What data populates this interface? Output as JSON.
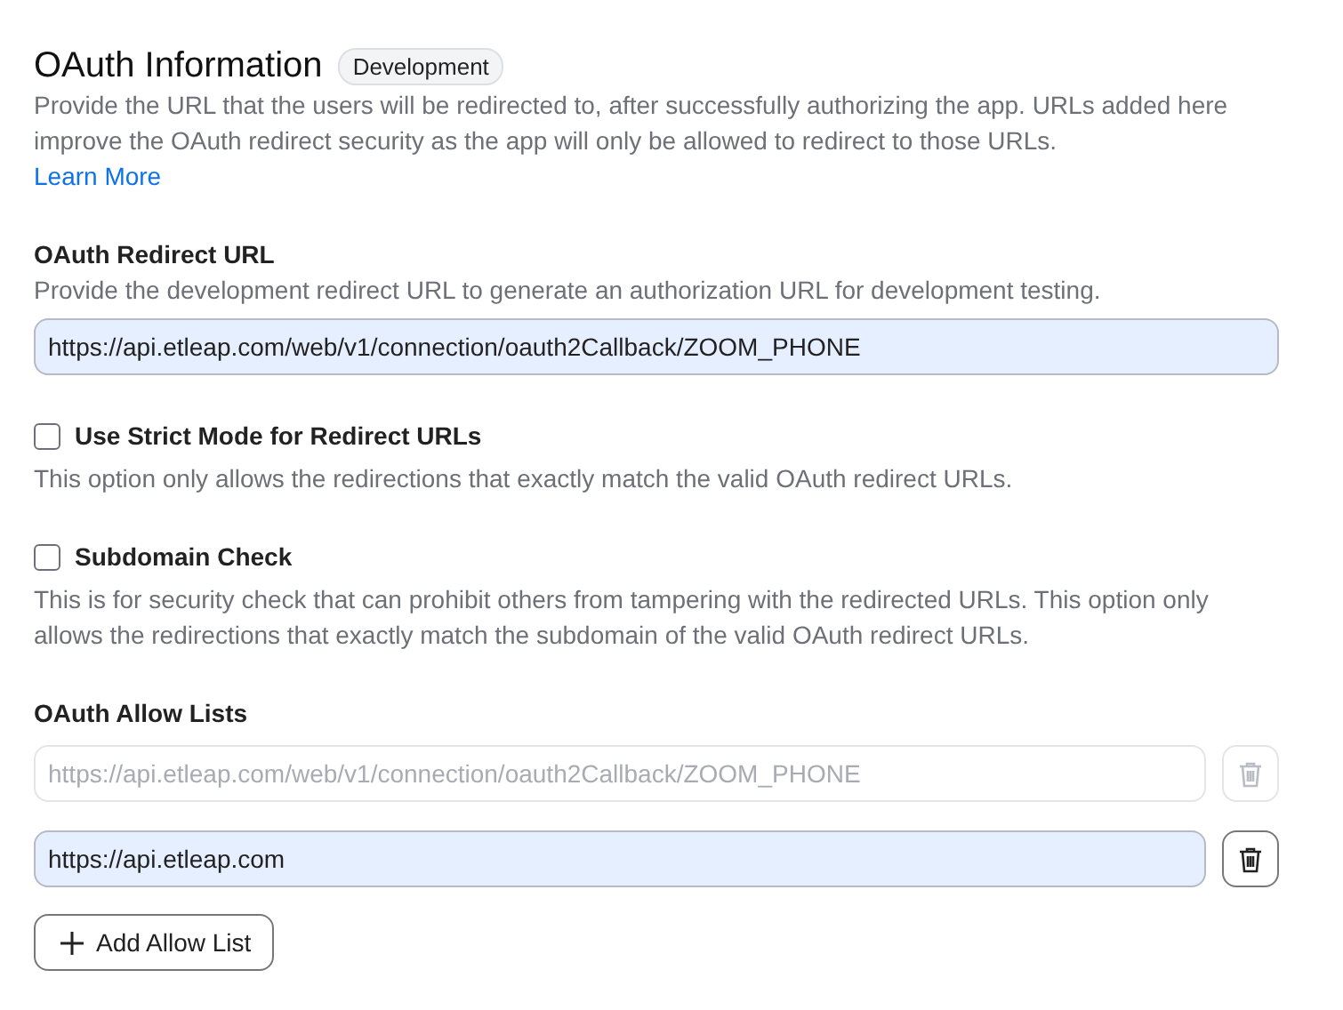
{
  "header": {
    "title": "OAuth Information",
    "badge": "Development",
    "description": "Provide the URL that the users will be redirected to, after successfully authorizing the app. URLs added here improve the OAuth redirect security as the app will only be allowed to redirect to those URLs.",
    "link": "Learn More"
  },
  "redirect_url": {
    "label": "OAuth Redirect URL",
    "description": "Provide the development redirect URL to generate an authorization URL for development testing.",
    "value": "https://api.etleap.com/web/v1/connection/oauth2Callback/ZOOM_PHONE"
  },
  "options": [
    {
      "label": "Use Strict Mode for Redirect URLs",
      "checked": false,
      "description": "This option only allows the redirections that exactly match the valid OAuth redirect URLs."
    },
    {
      "label": "Subdomain Check",
      "checked": false,
      "description": "This is for security check that can prohibit others from tampering with the redirected URLs. This option only allows the redirections that exactly match the subdomain of the valid OAuth redirect URLs."
    }
  ],
  "allow_lists": {
    "label": "OAuth Allow Lists",
    "items": [
      {
        "value": "https://api.etleap.com/web/v1/connection/oauth2Callback/ZOOM_PHONE",
        "disabled": true
      },
      {
        "value": "https://api.etleap.com",
        "disabled": false
      }
    ],
    "add_button": "Add Allow List"
  }
}
